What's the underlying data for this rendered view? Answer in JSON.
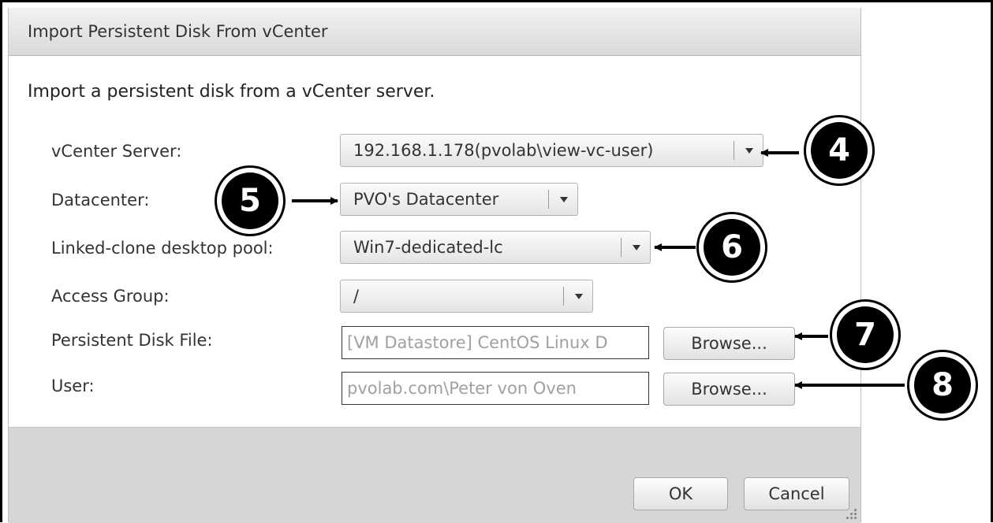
{
  "dialog": {
    "title": "Import Persistent Disk From vCenter",
    "description": "Import a persistent disk from a vCenter server."
  },
  "form": {
    "vcenter_label": "vCenter Server:",
    "vcenter_value": "192.168.1.178(pvolab\\view-vc-user)",
    "datacenter_label": "Datacenter:",
    "datacenter_value": "PVO's Datacenter",
    "pool_label": "Linked-clone desktop pool:",
    "pool_value": "Win7-dedicated-lc",
    "access_group_label": "Access Group:",
    "access_group_value": "/",
    "disk_file_label": "Persistent Disk File:",
    "disk_file_value": "[VM Datastore] CentOS Linux D",
    "user_label": "User:",
    "user_value": "pvolab.com\\Peter von Oven",
    "browse_label": "Browse..."
  },
  "footer": {
    "ok_label": "OK",
    "cancel_label": "Cancel"
  },
  "callouts": [
    "4",
    "5",
    "6",
    "7",
    "8"
  ],
  "colors": {
    "titlebar": "#d9d9d9",
    "footer": "#d6d6d6",
    "callout": "#000000"
  }
}
